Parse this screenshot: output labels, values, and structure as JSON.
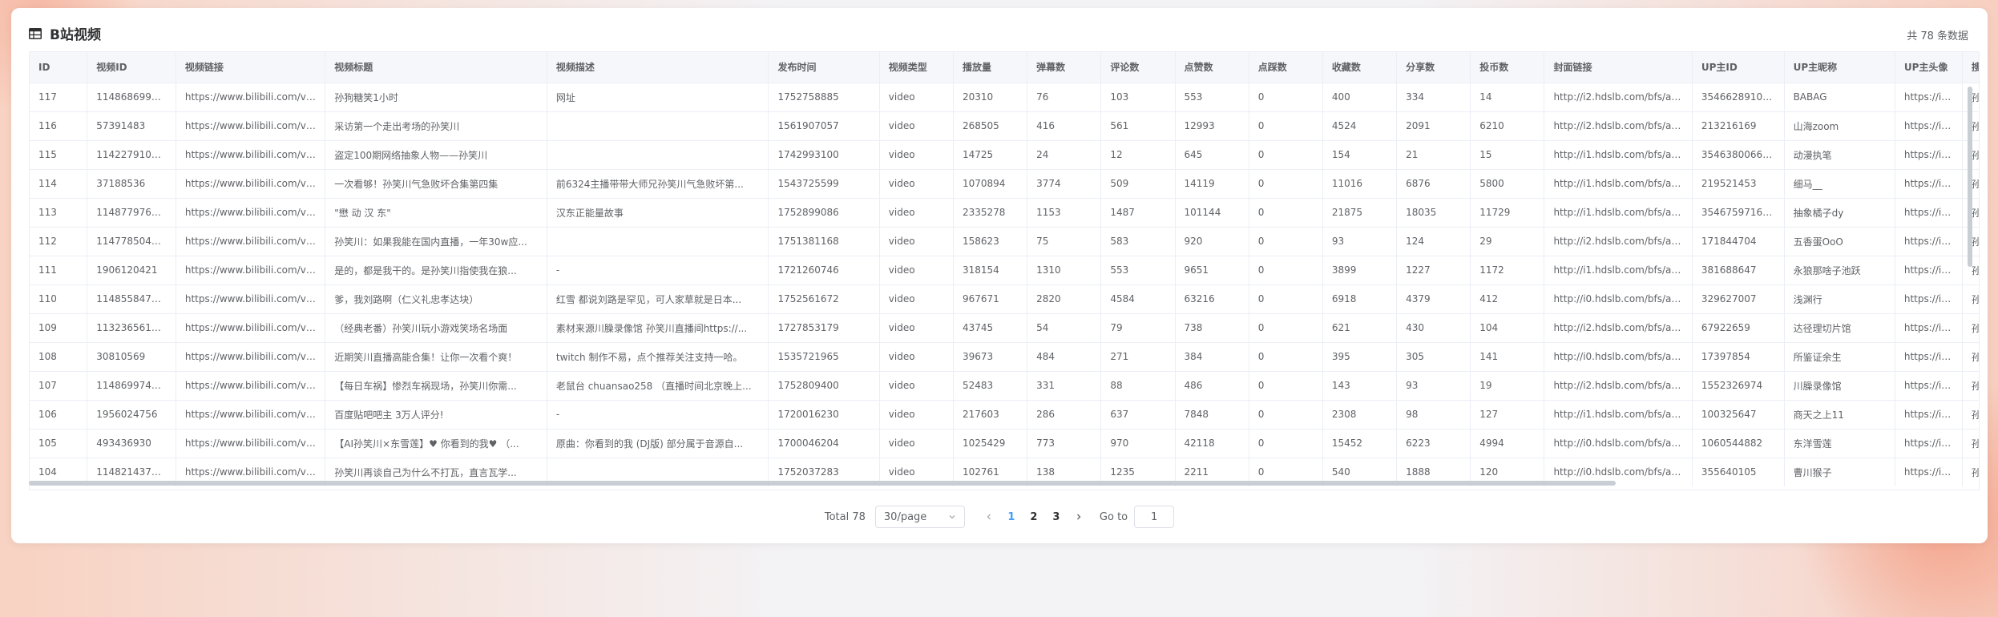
{
  "header": {
    "title": "B站视频",
    "total_text": "共 78 条数据"
  },
  "table": {
    "columns": [
      "ID",
      "视频ID",
      "视频链接",
      "视频标题",
      "视频描述",
      "发布时间",
      "视频类型",
      "播放量",
      "弹幕数",
      "评论数",
      "点赞数",
      "点踩数",
      "收藏数",
      "分享数",
      "投币数",
      "封面链接",
      "UP主ID",
      "UP主昵称",
      "UP主头像",
      "搜索关键"
    ],
    "rows": [
      [
        "117",
        "11486869914...",
        "https://www.bilibili.com/vi...",
        "孙狗糖笑1小时",
        "网址",
        "1752758885",
        "video",
        "20310",
        "76",
        "103",
        "553",
        "0",
        "400",
        "334",
        "14",
        "http://i2.hdslb.com/bfs/ar...",
        "35466289107...",
        "BABAG",
        "https://i1....",
        "孙笑川"
      ],
      [
        "116",
        "57391483",
        "https://www.bilibili.com/vi...",
        "采访第一个走出考场的孙笑川",
        "",
        "1561907057",
        "video",
        "268505",
        "416",
        "561",
        "12993",
        "0",
        "4524",
        "2091",
        "6210",
        "http://i2.hdslb.com/bfs/ar...",
        "213216169",
        "山海zoom",
        "https://i1.h...",
        "孙笑川"
      ],
      [
        "115",
        "11422791008...",
        "https://www.bilibili.com/vi...",
        "盗定100期网络抽象人物——孙笑川",
        "",
        "1742993100",
        "video",
        "14725",
        "24",
        "12",
        "645",
        "0",
        "154",
        "21",
        "15",
        "http://i1.hdslb.com/bfs/ar...",
        "35463800668...",
        "动漫执笔",
        "https://i0....",
        "孙笑川"
      ],
      [
        "114",
        "37188536",
        "https://www.bilibili.com/vi...",
        "一次看够！孙笑川气急败坏合集第四集",
        "前6324主播带带大师兄孙笑川气急败坏第...",
        "1543725599",
        "video",
        "1070894",
        "3774",
        "509",
        "14119",
        "0",
        "11016",
        "6876",
        "5800",
        "http://i1.hdslb.com/bfs/ar...",
        "219521453",
        "细马__",
        "https://i0....",
        "孙笑川"
      ],
      [
        "113",
        "11487797680...",
        "https://www.bilibili.com/vi...",
        "\"懋 动 汉 东\"",
        "汉东正能量故事",
        "1752899086",
        "video",
        "2335278",
        "1153",
        "1487",
        "101144",
        "0",
        "21875",
        "18035",
        "11729",
        "http://i1.hdslb.com/bfs/ar...",
        "35467597164...",
        "抽象橘子dy",
        "https://i2....",
        "孙笑川"
      ],
      [
        "112",
        "11477850469...",
        "https://www.bilibili.com/vi...",
        "孙笑川：如果我能在国内直播，一年30w应...",
        "",
        "1751381168",
        "video",
        "158623",
        "75",
        "583",
        "920",
        "0",
        "93",
        "124",
        "29",
        "http://i2.hdslb.com/bfs/ar...",
        "171844704",
        "五香蛋OoO",
        "https://i2....",
        "孙笑川"
      ],
      [
        "111",
        "1906120421",
        "https://www.bilibili.com/vi...",
        "是的，都是我干的。是孙笑川指使我在狼...",
        "-",
        "1721260746",
        "video",
        "318154",
        "1310",
        "553",
        "9651",
        "0",
        "3899",
        "1227",
        "1172",
        "http://i1.hdslb.com/bfs/ar...",
        "381688647",
        "永狼那啥子池跃",
        "https://i0....",
        "孙笑川"
      ],
      [
        "110",
        "11485584765...",
        "https://www.bilibili.com/vi...",
        "爹，我刘路啊（仁义礼忠孝达块）",
        "红雪 都说刘路是罕见，可人家草就是日本...",
        "1752561672",
        "video",
        "967671",
        "2820",
        "4584",
        "63216",
        "0",
        "6918",
        "4379",
        "412",
        "http://i0.hdslb.com/bfs/ar...",
        "329627007",
        "浅渊行",
        "https://i0....",
        "孙笑川"
      ],
      [
        "109",
        "11323656117...",
        "https://www.bilibili.com/vi...",
        "（经典老番）孙笑川玩小游戏笑场名场面",
        "素材来源川臊录像馆 孙笑川直播间https://...",
        "1727853179",
        "video",
        "43745",
        "54",
        "79",
        "738",
        "0",
        "621",
        "430",
        "104",
        "http://i2.hdslb.com/bfs/ar...",
        "67922659",
        "达径理切片馆",
        "https://i2....",
        "孙笑川"
      ],
      [
        "108",
        "30810569",
        "https://www.bilibili.com/vi...",
        "近期笑川直播高能合集！让你一次看个爽！",
        "twitch 制作不易，点个推荐关注支持一哈。",
        "1535721965",
        "video",
        "39673",
        "484",
        "271",
        "384",
        "0",
        "395",
        "305",
        "141",
        "http://i0.hdslb.com/bfs/ar...",
        "17397854",
        "所鉴证余生",
        "https://i0.h...",
        "孙笑川"
      ],
      [
        "107",
        "11486997407...",
        "https://www.bilibili.com/vi...",
        "【每日车祸】惨烈车祸现场，孙笑川你需...",
        "老鼠台 chuansao258 （直播时间北京晚上...",
        "1752809400",
        "video",
        "52483",
        "331",
        "88",
        "486",
        "0",
        "143",
        "93",
        "19",
        "http://i2.hdslb.com/bfs/ar...",
        "1552326974",
        "川臊录像馆",
        "https://i2....",
        "孙笑川"
      ],
      [
        "106",
        "1956024756",
        "https://www.bilibili.com/vi...",
        "百度贴吧吧主 3万人评分!",
        "-",
        "1720016230",
        "video",
        "217603",
        "286",
        "637",
        "7848",
        "0",
        "2308",
        "98",
        "127",
        "http://i1.hdslb.com/bfs/ar...",
        "100325647",
        "商天之上11",
        "https://i1....",
        "孙笑川"
      ],
      [
        "105",
        "493436930",
        "https://www.bilibili.com/vi...",
        "【AI孙笑川×东雪莲】♥ 你看到的我♥ （...",
        "原曲：你看到的我 (DJ版) 部分属于音源自...",
        "1700046204",
        "video",
        "1025429",
        "773",
        "970",
        "42118",
        "0",
        "15452",
        "6223",
        "4994",
        "http://i0.hdslb.com/bfs/ar...",
        "1060544882",
        "东洋雪莲",
        "https://i2....",
        "孙笑川"
      ],
      [
        "104",
        "11482143759...",
        "https://www.bilibili.com/vi...",
        "孙笑川再谈自己为什么不打瓦，直言瓦学...",
        "",
        "1752037283",
        "video",
        "102761",
        "138",
        "1235",
        "2211",
        "0",
        "540",
        "1888",
        "120",
        "http://i0.hdslb.com/bfs/ar...",
        "355640105",
        "曹川猴子",
        "https://i2....",
        "孙笑川"
      ]
    ]
  },
  "pagination": {
    "total_label": "Total 78",
    "page_size": "30/page",
    "pages": [
      "1",
      "2",
      "3"
    ],
    "current_page": "1",
    "goto_label": "Go to",
    "goto_value": "1"
  },
  "colors": {
    "accent": "#409eff",
    "header_bg": "#f5f7fa",
    "border": "#ebeef5"
  },
  "icons": {
    "title_icon": "table-icon",
    "page_size_chevron": "chevron-down-icon",
    "prev": "chevron-left-icon",
    "next": "chevron-right-icon"
  }
}
